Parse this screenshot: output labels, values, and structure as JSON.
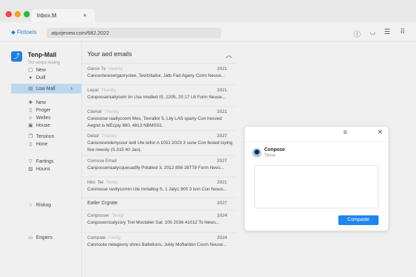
{
  "browser": {
    "tab_title": "Inbox.M",
    "brand": "Fintoets",
    "url": "atpojenew.com/682.2022"
  },
  "sidebar": {
    "title": "Tenp-Mail",
    "subtitle": "Thr emps losing",
    "items": [
      {
        "label": "New",
        "icon": "compose-icon"
      },
      {
        "label": "Duill",
        "icon": "person-icon"
      },
      {
        "label": "Low Mall",
        "icon": "inbox-icon"
      },
      {
        "label": "New",
        "icon": "plus-icon"
      },
      {
        "label": "Proger",
        "icon": "book-icon"
      },
      {
        "label": "Weiles",
        "icon": "smile-icon"
      },
      {
        "label": "House",
        "icon": "file-icon"
      },
      {
        "label": "Tersinos",
        "icon": "copy-icon"
      },
      {
        "label": "Hone",
        "icon": "document-icon"
      },
      {
        "label": "Fartings",
        "icon": "shield-icon"
      },
      {
        "label": "Houns",
        "icon": "image-icon"
      },
      {
        "label": "Riskog",
        "icon": "circle-icon"
      },
      {
        "label": "Engiers",
        "icon": "monitor-icon"
      }
    ]
  },
  "list": {
    "header": "Your aed emails",
    "emails": [
      {
        "sender": "Garce 7s",
        "tag": "Nearby",
        "year": "2021",
        "preview": "Cancecteresergaoryclee, Tevitzitailor, Jatb Fad Agany Corm Neuse..."
      },
      {
        "sender": "Lepal",
        "tag": "Thenby",
        "year": "2021",
        "preview": "Conposseniaitycom im Use Imolled IS, 2205, 20 17 L6 Form Neuse..."
      },
      {
        "sender": "Clamal",
        "tag": "Thenby",
        "year": "2021",
        "preview": "Conoosse raaltycoom Mes, Tevrallor 5, Lity LAS spany Con hesved Aegnd is MEcpiy 880, 4813 NBMSS1."
      },
      {
        "sender": "Detail",
        "tag": "Thenby",
        "year": "2027",
        "preview": "Cansosrendenycour tedl Ute tellor A 1051 2023 3 sune Con fesied loying fow newsly (S.315 40 Jao)."
      },
      {
        "sender": "Comose Email",
        "tag": "",
        "year": "2027",
        "preview": "Canpossenaatycquesadify Polatied 3, 2012 856 28T78 Form Nevs..."
      },
      {
        "sender": "htto: Tet",
        "tag": "Tenby",
        "year": "2021",
        "preview": "Connosse rastlycomin Ute Inntallog S, 1 Jaly1 900 3 tvm Con hesus..."
      },
      {
        "sender": "Eatler Crgrate",
        "tag": "",
        "year": "2027",
        "preview": ""
      },
      {
        "sender": "Conposser",
        "tag": "Tenigl",
        "year": "2024",
        "preview": "Conposerncalycory Trel Moctalier Sat, 105 2036 41012 To News..."
      },
      {
        "sender": "Compate",
        "tag": "Feeity",
        "year": "2024",
        "preview": "Cannoote netageory shres Baltetions, Jukly Moflardon Cosm Neuse..."
      }
    ]
  },
  "compose": {
    "title": "Conpose",
    "subtitle": "Tilone",
    "body": "",
    "send_label": "Compaste"
  }
}
